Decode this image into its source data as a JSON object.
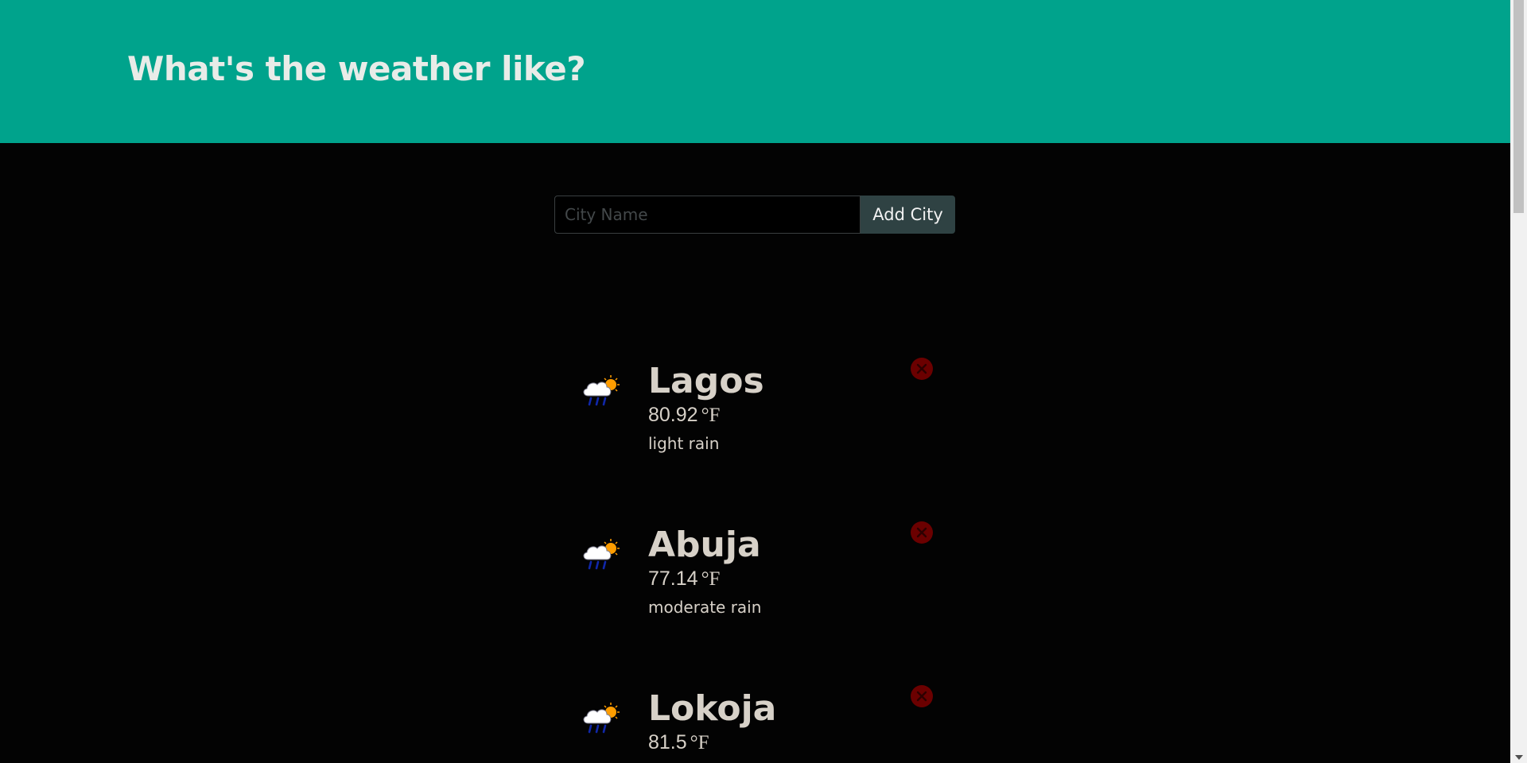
{
  "header": {
    "title": "What's the weather like?",
    "background": "#00a38c"
  },
  "search": {
    "placeholder": "City Name",
    "value": "",
    "button_label": "Add City"
  },
  "cities": [
    {
      "name": "Lagos",
      "temperature": "80.92",
      "unit": "°F",
      "description": "light rain",
      "icon": "rain-cloud-sun-icon"
    },
    {
      "name": "Abuja",
      "temperature": "77.14",
      "unit": "°F",
      "description": "moderate rain",
      "icon": "rain-cloud-sun-icon"
    },
    {
      "name": "Lokoja",
      "temperature": "81.5",
      "unit": "°F",
      "description": "",
      "icon": "rain-cloud-sun-icon"
    }
  ],
  "colors": {
    "accent": "#00a38c",
    "delete": "#6b0000",
    "text": "#d7d1c8"
  }
}
